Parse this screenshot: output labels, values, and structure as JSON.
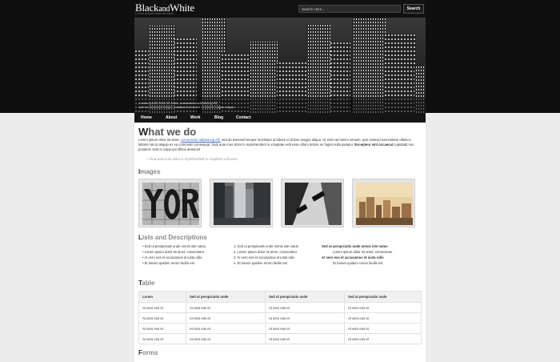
{
  "site": {
    "logo_left": "Black",
    "logo_mid": "and",
    "logo_right": "White",
    "tagline": "Lorem ipsum dolor sit amet"
  },
  "search": {
    "placeholder": "Search Here...",
    "button_label": "Search"
  },
  "hero": {
    "caption_1": "Lorem ipsum dolor sit amet, consectetur adipisicing elit,",
    "caption_2": "sed do eiusmod tempor incididunt ut labore et dolore magna aliqua."
  },
  "nav": [
    "Home",
    "About",
    "Work",
    "Blog",
    "Contact"
  ],
  "what_we_do": {
    "title_first": "W",
    "title_rest": "hat we do",
    "para_1": "Lorem ipsum dolor sit amet,",
    "para_link": "consectetur adipisicing elit,",
    "para_2": "sed do eiusmod tempor incididunt ut labore et dolore magna aliqua. Ut enim ad minim veniam, quis nostrud exercitation ullamco laboris nisi ut aliquip ex ea commodo consequat. Duis aute irure dolor in reprehenderit in voluptate velit esse cillum dolore eu fugiat nulla pariatur.",
    "para_bold": "Excepteur sint occaecat",
    "para_3": "cupidatat non proident, sunt in culpa qui officia deserunt",
    "quote": "— Duis aute irure dolor in reprehenderit in voluptate velit esse"
  },
  "images_section": {
    "title_first": "I",
    "title_rest": "mages"
  },
  "lists_section": {
    "title_first": "L",
    "title_rest": "ists and Descriptions",
    "unordered": [
      "Sed ut perspiciatis unde omnis iste natus",
      "Lorem ipsum dolor sit amet, consectetur",
      "At vero eos et accusamus et iusto odio",
      "Et harum quidem rerum facilis est"
    ],
    "ordered": [
      "1. Sed ut perspiciatis unde omnis iste natus",
      "2. Lorem ipsum dolor sit amet, consectetur",
      "3. At vero eos et accusamus et iusto odio",
      "4. Et harum quidem rerum facilis est"
    ],
    "definitions": [
      {
        "term": "Sed ut perspiciatis unde omnis iste natus",
        "desc": "Lorem ipsum dolor sit amet, consectetur"
      },
      {
        "term": "At vero eos et accusamus et iusto odio",
        "desc": "Et harum quidem rerum facilis est"
      }
    ]
  },
  "table_section": {
    "title_first": "T",
    "title_rest": "able",
    "headers": [
      "Lorem",
      "Sed ut perspiciatis unde",
      "Sed ut perspiciatis unde",
      "Sed ut perspiciatis unde"
    ],
    "rows": [
      [
        "At vero eos et",
        "At vero eos et",
        "At vero eos et",
        "At vero eos et"
      ],
      [
        "At vero eos et",
        "At vero eos et",
        "At vero eos et",
        "At vero eos et"
      ],
      [
        "At vero eos et",
        "At vero eos et",
        "At vero eos et",
        "At vero eos et"
      ],
      [
        "At vero eos et",
        "At vero eos et",
        "At vero eos et",
        "At vero eos et"
      ]
    ]
  },
  "forms_section": {
    "title_first": "F",
    "title_rest": "orms"
  }
}
